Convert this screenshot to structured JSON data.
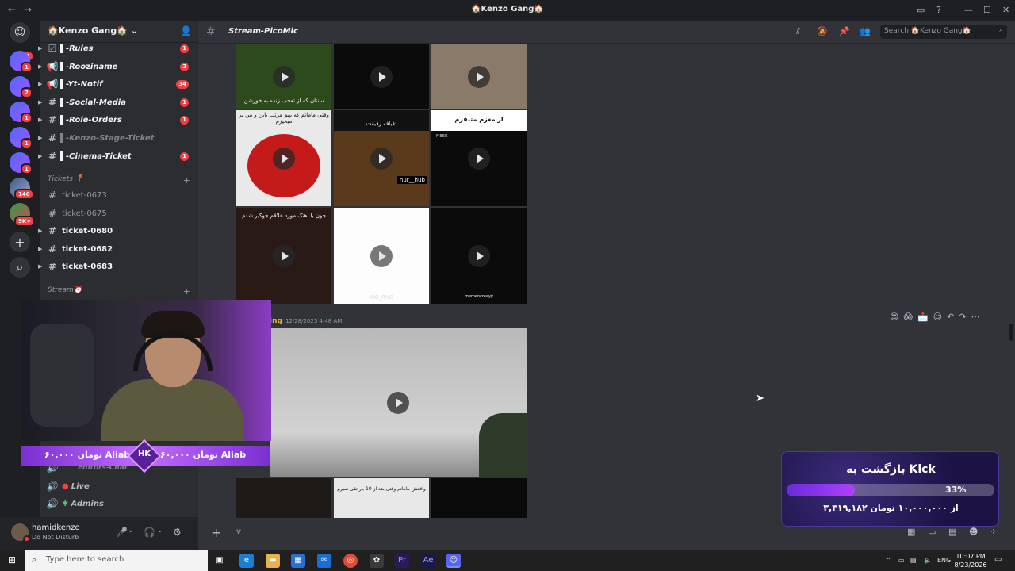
{
  "window": {
    "title": "🏠Kenzo Gang🏠",
    "back": "←",
    "forward": "→",
    "controls": [
      "▭",
      "?",
      "—",
      "☐",
      "✕"
    ]
  },
  "servers": {
    "home_badge": "621",
    "badges": [
      "1",
      "2",
      "1",
      "1",
      "1",
      "1",
      "140",
      "9K+"
    ]
  },
  "guild": {
    "name": "🏠Kenzo Gang🏠"
  },
  "channels": [
    {
      "name": "-Rules",
      "icon": "☑",
      "badge": "1"
    },
    {
      "name": "-Rooziname",
      "icon": "📢",
      "badge": "2"
    },
    {
      "name": "-Yt-Notif",
      "icon": "📢",
      "badge": "34"
    },
    {
      "name": "-Social-Media",
      "icon": "#",
      "badge": "1"
    },
    {
      "name": "-Role-Orders",
      "icon": "#",
      "badge": "1"
    },
    {
      "name": "-Kenzo-Stage-Ticket",
      "icon": "#",
      "badge": ""
    },
    {
      "name": "-Cinema-Ticket",
      "icon": "#",
      "badge": "1"
    }
  ],
  "tickets_category": "Tickets 📍",
  "tickets": [
    {
      "name": "ticket-0673",
      "unread": false
    },
    {
      "name": "ticket-0675",
      "unread": false
    },
    {
      "name": "ticket-0680",
      "unread": true
    },
    {
      "name": "ticket-0682",
      "unread": true
    },
    {
      "name": "ticket-0683",
      "unread": true
    }
  ],
  "stream_category": "Stream⏰",
  "voice_channels": [
    {
      "name": "Editors-Chat"
    },
    {
      "name": "Live"
    },
    {
      "name": "Admins"
    }
  ],
  "user": {
    "name": "hamidkenzo",
    "status": "Do Not Disturb"
  },
  "channel_header": {
    "name": "Stream-PicoMic",
    "search_placeholder": "Search 🏠Kenzo Gang🏠"
  },
  "grid_captions": {
    "c1": "سنتان که از تعجب زنده به خورشن",
    "d1": "وقتی ماماتم که بهم مرتب بابن و من بر میخیزم",
    "d2": "فیافه رفیقت:",
    "d2b": "nur__hub",
    "d3": "از مغزم متنفرم",
    "d3b": "FIBER",
    "e1": "چون با اهنگ مورد علاقم جوگیر شدم",
    "e2": "AKI_RNB",
    "e3": "memencreayy",
    "f2": "واقعش ماماتم وقتی بعد از 10 بار تقی نمیرم"
  },
  "message": {
    "author": "ing",
    "timestamp": "12/28/2025 4:48 AM"
  },
  "donation": {
    "left_text": "۶۰,۰۰۰ تومان Aliab",
    "mid": "HK",
    "right_text": "۶۰,۰۰۰ تومان Aliab"
  },
  "kick_goal": {
    "title": "بازگشت به Kick",
    "percent": "33%",
    "fraction": 0.33,
    "amount": "۳,۳۱۹,۱۸۲ از ۱۰,۰۰۰,۰۰۰ تومان"
  },
  "taskbar": {
    "search_placeholder": "Type here to search",
    "lang": "ENG",
    "time": "10:07 PM",
    "date": "8/23/2026"
  }
}
